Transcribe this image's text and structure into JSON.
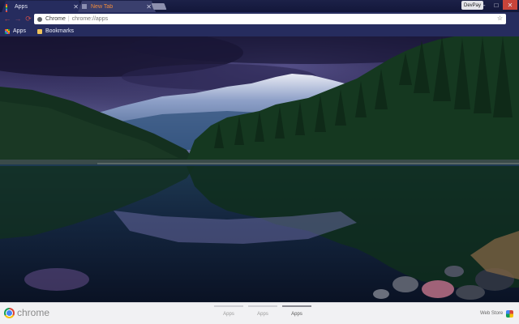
{
  "tabs": [
    {
      "title": "Apps",
      "active": true
    },
    {
      "title": "New Tab",
      "active": false
    }
  ],
  "window": {
    "user_name": "DevPay",
    "minimize_glyph": "–",
    "maximize_glyph": "□",
    "close_glyph": "✕"
  },
  "toolbar": {
    "back_glyph": "←",
    "forward_glyph": "→",
    "reload_glyph": "⟳",
    "omnibox_scheme": "Chrome",
    "omnibox_separator": "|",
    "omnibox_url": "chrome://apps",
    "star_glyph": "☆"
  },
  "bookmarks": {
    "apps_label": "Apps",
    "folder_label": "Bookmarks"
  },
  "footer": {
    "wordmark": "chrome",
    "pages": [
      {
        "label": "Apps",
        "selected": false
      },
      {
        "label": "Apps",
        "selected": false
      },
      {
        "label": "Apps",
        "selected": true
      }
    ],
    "web_store_label": "Web Store"
  },
  "colors": {
    "frame": "#262c5e",
    "close_button": "#c7443a",
    "apps_grid": [
      "#e84c3d",
      "#f4b400",
      "#0f9d58",
      "#4285f4",
      "#e84c3d",
      "#f4b400",
      "#0f9d58",
      "#4285f4",
      "#e84c3d"
    ]
  },
  "icons": {
    "tab_close": "close-icon",
    "star": "star-icon",
    "folder": "folder-icon"
  }
}
